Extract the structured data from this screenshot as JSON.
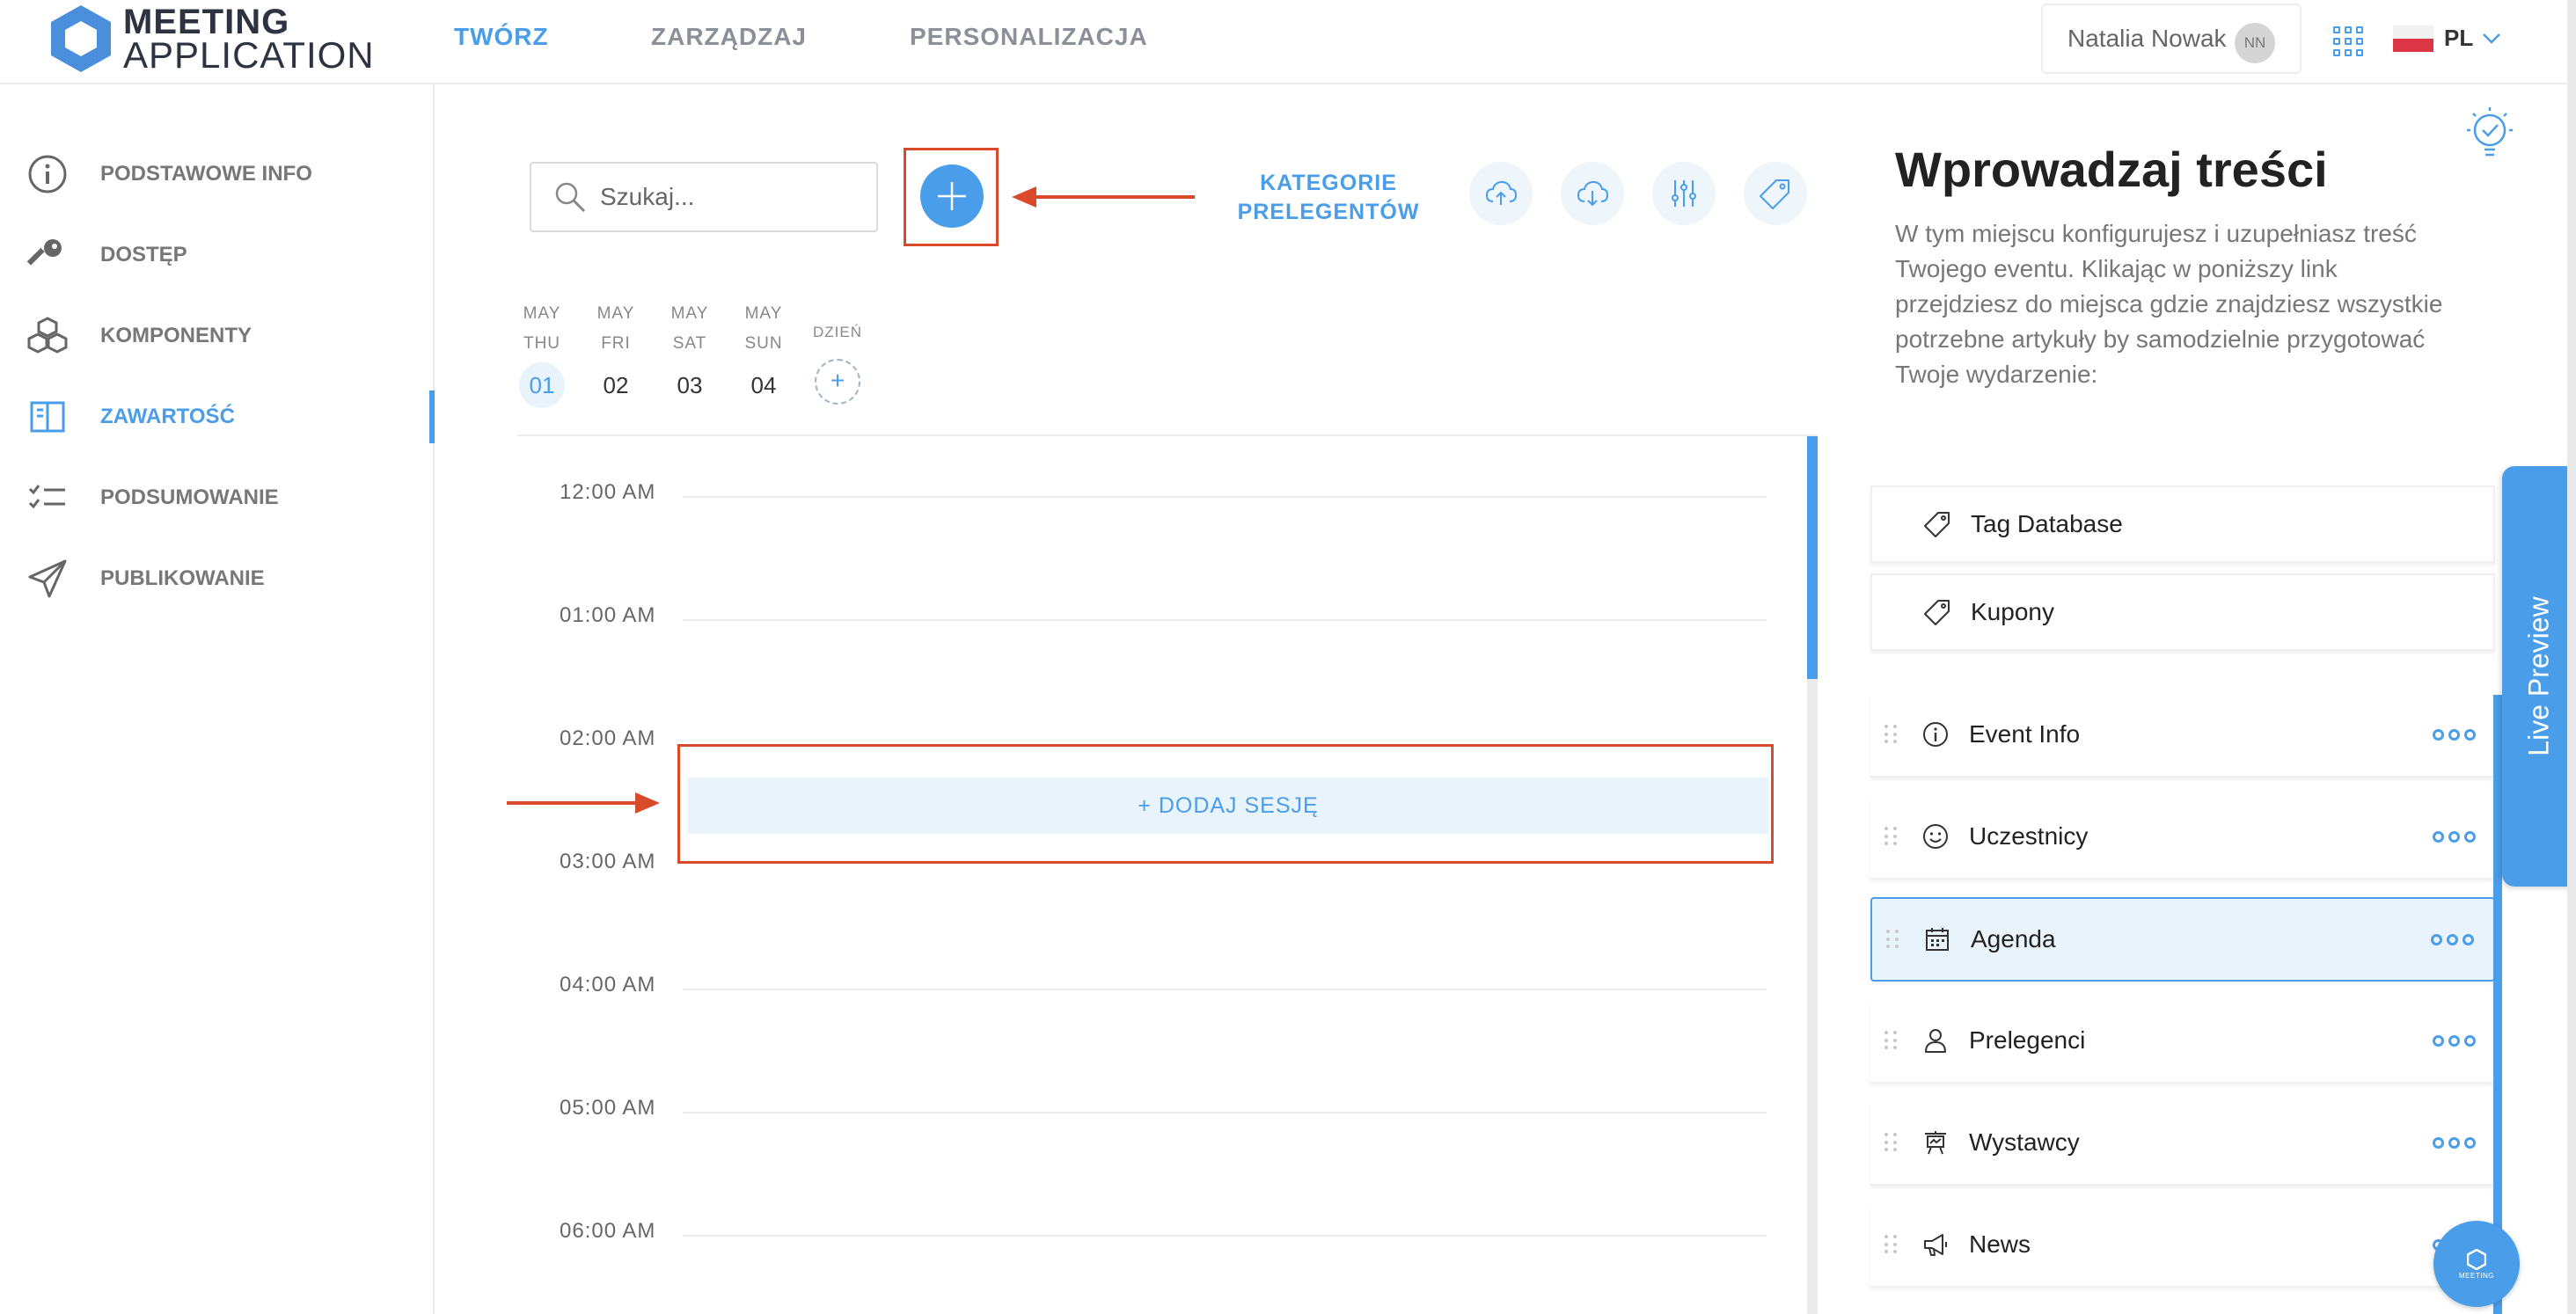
{
  "brand": {
    "line1": "MEETING",
    "line2": "APPLICATION"
  },
  "topnav": [
    {
      "label": "TWÓRZ",
      "active": true
    },
    {
      "label": "ZARZĄDZAJ",
      "active": false
    },
    {
      "label": "PERSONALIZACJA",
      "active": false
    }
  ],
  "user": {
    "name": "Natalia Nowak",
    "initials": "NN"
  },
  "language": "PL",
  "sidebar": {
    "items": [
      {
        "label": "PODSTAWOWE INFO",
        "icon": "info-icon"
      },
      {
        "label": "DOSTĘP",
        "icon": "key-icon"
      },
      {
        "label": "KOMPONENTY",
        "icon": "cubes-icon"
      },
      {
        "label": "ZAWARTOŚĆ",
        "icon": "content-icon",
        "active": true
      },
      {
        "label": "PODSUMOWANIE",
        "icon": "checklist-icon"
      },
      {
        "label": "PUBLIKOWANIE",
        "icon": "paper-plane-icon"
      }
    ]
  },
  "search": {
    "placeholder": "Szukaj..."
  },
  "toolbar": {
    "speaker_categories_line1": "KATEGORIE",
    "speaker_categories_line2": "PRELEGENTÓW"
  },
  "days": [
    {
      "month": "MAY",
      "weekday": "THU",
      "num": "01",
      "active": true
    },
    {
      "month": "MAY",
      "weekday": "FRI",
      "num": "02"
    },
    {
      "month": "MAY",
      "weekday": "SAT",
      "num": "03"
    },
    {
      "month": "MAY",
      "weekday": "SUN",
      "num": "04"
    }
  ],
  "add_day": {
    "label": "DZIEŃ",
    "symbol": "+"
  },
  "times": [
    "12:00 AM",
    "01:00 AM",
    "02:00 AM",
    "03:00 AM",
    "04:00 AM",
    "05:00 AM",
    "06:00 AM"
  ],
  "add_session": "+ DODAJ SESJĘ",
  "right_panel": {
    "title": "Wprowadzaj treści",
    "description": "W tym miejscu konfigurujesz i uzupełniasz treść Twojego eventu. Klikając w poniższy link przejdziesz do miejsca gdzie znajdziesz wszystkie potrzebne artykuły by samodzielnie przygotować Twoje wydarzenie:",
    "cards": [
      {
        "label": "Tag Database",
        "icon": "tag-icon"
      },
      {
        "label": "Kupony",
        "icon": "tag-icon"
      }
    ],
    "items": [
      {
        "label": "Event Info",
        "icon": "info-icon"
      },
      {
        "label": "Uczestnicy",
        "icon": "smiley-icon"
      },
      {
        "label": "Agenda",
        "icon": "calendar-icon",
        "active": true
      },
      {
        "label": "Prelegenci",
        "icon": "person-icon"
      },
      {
        "label": "Wystawcy",
        "icon": "booth-icon"
      },
      {
        "label": "News",
        "icon": "megaphone-icon"
      }
    ]
  },
  "live_preview": "Live Preview",
  "chat_logo": "MEETING",
  "colors": {
    "accent": "#4a9de8",
    "highlight": "#d94a2b",
    "text_muted": "#777777"
  }
}
